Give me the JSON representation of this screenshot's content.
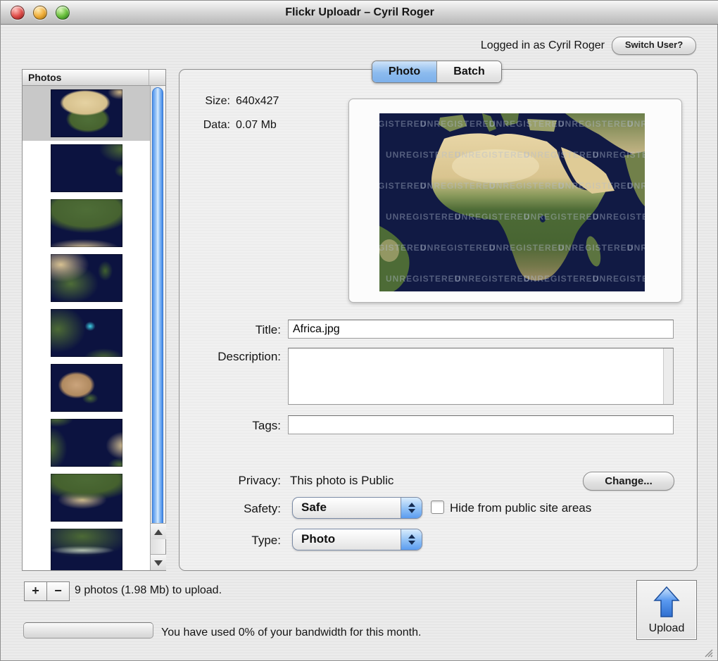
{
  "window": {
    "title": "Flickr Uploadr – Cyril Roger"
  },
  "session": {
    "logged_in_text": "Logged in as Cyril Roger",
    "switch_user_label": "Switch User?"
  },
  "tabs": [
    {
      "label": "Photo",
      "selected": true
    },
    {
      "label": "Batch",
      "selected": false
    }
  ],
  "sidebar": {
    "header": "Photos",
    "thumbnails": [
      {
        "id": "africa",
        "selected": true
      },
      {
        "id": "south-atlantic",
        "selected": false
      },
      {
        "id": "europe",
        "selected": false
      },
      {
        "id": "east-asia",
        "selected": false
      },
      {
        "id": "caribbean",
        "selected": false
      },
      {
        "id": "australia",
        "selected": false
      },
      {
        "id": "north-atlantic",
        "selected": false
      },
      {
        "id": "asia",
        "selected": false
      },
      {
        "id": "north-america",
        "selected": false
      }
    ]
  },
  "photo_info": {
    "size_label": "Size:",
    "size_value": "640x427",
    "data_label": "Data:",
    "data_value": "0.07 Mb"
  },
  "preview": {
    "watermark": "UNREGISTERED"
  },
  "form": {
    "title_label": "Title:",
    "title_value": "Africa.jpg",
    "description_label": "Description:",
    "description_value": "",
    "tags_label": "Tags:",
    "tags_value": "",
    "privacy_label": "Privacy:",
    "privacy_value": "This photo is Public",
    "change_button_label": "Change...",
    "safety_label": "Safety:",
    "safety_value": "Safe",
    "hide_checkbox_label": "Hide from public site areas",
    "hide_checked": false,
    "type_label": "Type:",
    "type_value": "Photo"
  },
  "footer": {
    "add_label": "+",
    "remove_label": "−",
    "count_text": "9 photos (1.98 Mb) to upload.",
    "bandwidth_percent": 0,
    "bandwidth_text": "You have used 0% of your bandwidth for this month.",
    "upload_label": "Upload"
  },
  "colors": {
    "selected_tab_blue": "#7db0ea",
    "scrollbar_blue": "#5b9cf0",
    "upload_arrow_blue": "#2f6fd0",
    "ocean_navy": "#0c1340"
  }
}
